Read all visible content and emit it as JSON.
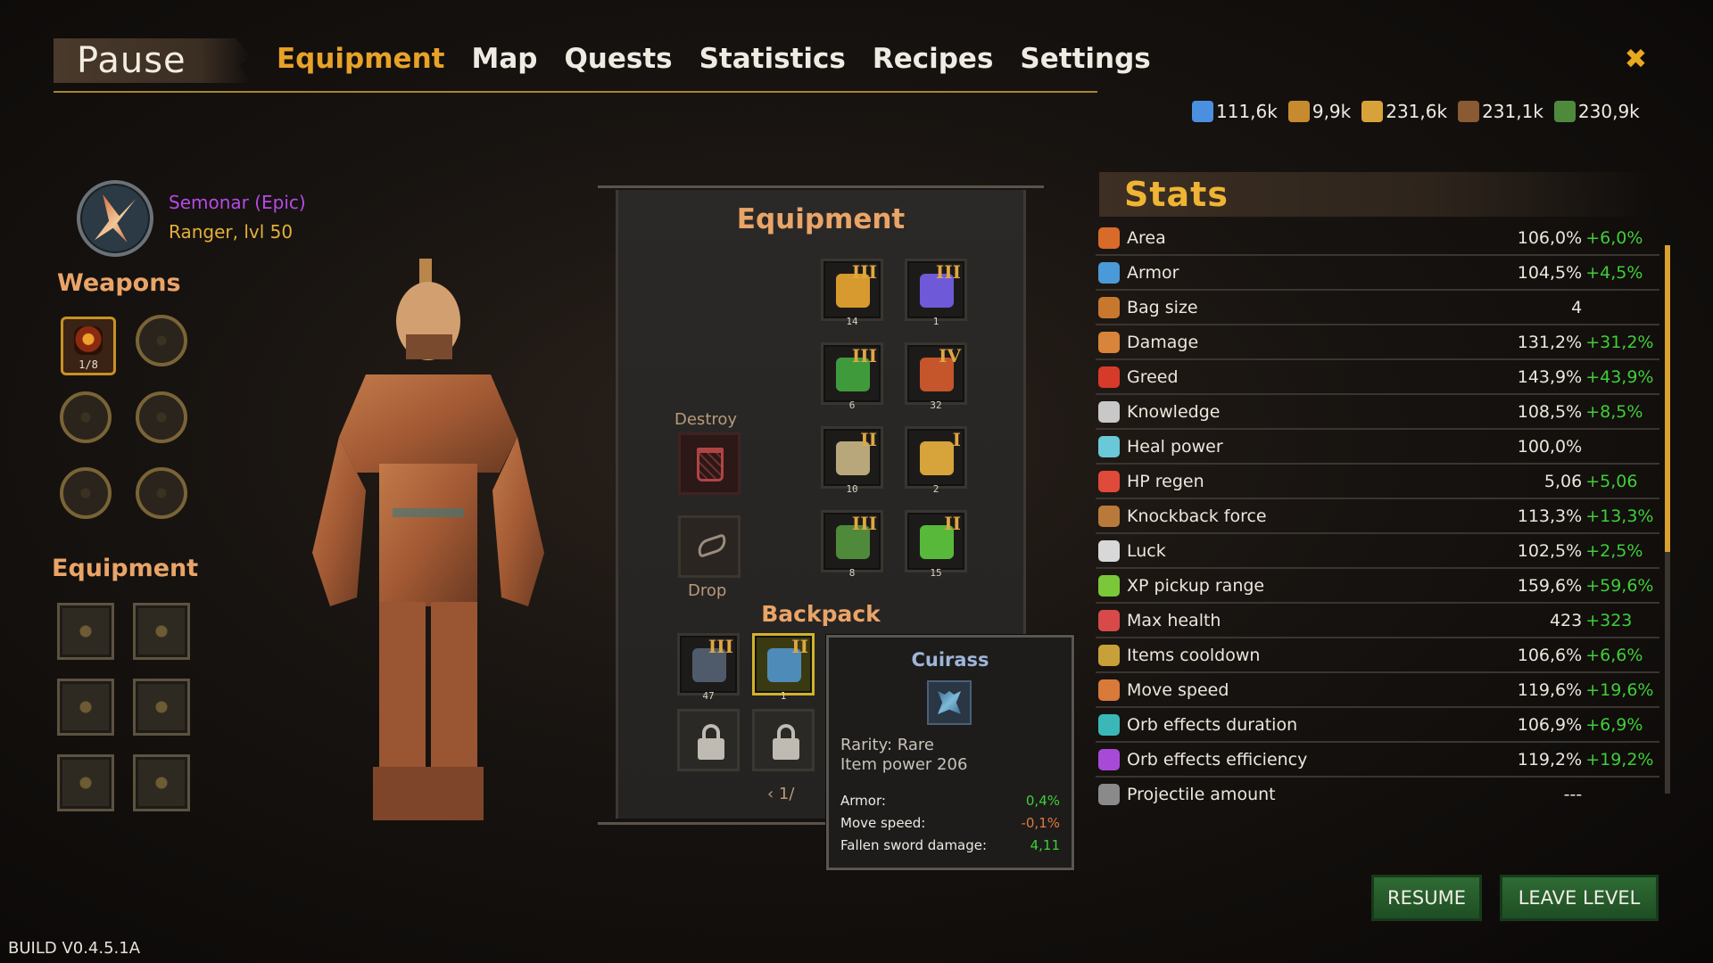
{
  "nav": {
    "pause": "Pause",
    "tabs": [
      "Equipment",
      "Map",
      "Quests",
      "Statistics",
      "Recipes",
      "Settings"
    ],
    "active": "Equipment",
    "close_icon": "close-x-icon"
  },
  "resources": [
    {
      "icon": "crystal-icon",
      "value": "111,6k",
      "color": "#4a8fe0"
    },
    {
      "icon": "bread-icon",
      "value": "9,9k",
      "color": "#c88a2e"
    },
    {
      "icon": "gold-pouch-icon",
      "value": "231,6k",
      "color": "#d8a23a"
    },
    {
      "icon": "wood-icon",
      "value": "231,1k",
      "color": "#8a5a32"
    },
    {
      "icon": "potion-icon",
      "value": "230,9k",
      "color": "#4f8a3c"
    }
  ],
  "hero": {
    "name": "Semonar (Epic)",
    "class": "Ranger, lvl 50"
  },
  "weapons": {
    "title": "Weapons",
    "active_count": "1/8"
  },
  "left_equipment": {
    "title": "Equipment"
  },
  "equipment_panel": {
    "title": "Equipment",
    "slots": [
      {
        "tier": "III",
        "level": "14",
        "name": "helmet-icon",
        "color": "#d79a2e"
      },
      {
        "tier": "III",
        "level": "1",
        "name": "gauntlet-icon",
        "color": "#6e5ad8"
      },
      {
        "tier": "III",
        "level": "6",
        "name": "amulet-icon",
        "color": "#3f9a3c"
      },
      {
        "tier": "IV",
        "level": "32",
        "name": "gloves-icon",
        "color": "#c5552b"
      },
      {
        "tier": "II",
        "level": "10",
        "name": "pants-icon",
        "color": "#b8a77a"
      },
      {
        "tier": "I",
        "level": "2",
        "name": "ring-icon",
        "color": "#d6a43a"
      },
      {
        "tier": "III",
        "level": "8",
        "name": "boots-icon",
        "color": "#4e8a3a"
      },
      {
        "tier": "II",
        "level": "15",
        "name": "bracelet-icon",
        "color": "#58b83a"
      }
    ],
    "destroy_label": "Destroy",
    "drop_label": "Drop"
  },
  "backpack": {
    "title": "Backpack",
    "items": [
      {
        "tier": "III",
        "level": "47",
        "name": "chest-armor-icon",
        "color": "#4f5b6a"
      },
      {
        "tier": "II",
        "level": "1",
        "name": "cuirass-icon",
        "color": "#4f8bb8"
      }
    ],
    "pager": "‹  1/"
  },
  "tooltip": {
    "title": "Cuirass",
    "rarity": "Rarity: Rare",
    "power": "Item power 206",
    "stats": [
      {
        "name": "Armor:",
        "value": "0,4%",
        "sign": "pos"
      },
      {
        "name": "Move speed:",
        "value": "-0,1%",
        "sign": "neg"
      },
      {
        "name": "Fallen sword damage:",
        "value": "4,11",
        "sign": "pos"
      }
    ]
  },
  "stats": {
    "title": "Stats",
    "rows": [
      {
        "icon": "area-icon",
        "color": "#d86a2a",
        "name": "Area",
        "value": "106,0%",
        "bonus": "+6,0%"
      },
      {
        "icon": "armor-icon",
        "color": "#4a9ad8",
        "name": "Armor",
        "value": "104,5%",
        "bonus": "+4,5%"
      },
      {
        "icon": "bag-icon",
        "color": "#c8782e",
        "name": "Bag size",
        "value": "4",
        "bonus": ""
      },
      {
        "icon": "damage-icon",
        "color": "#d8843a",
        "name": "Damage",
        "value": "131,2%",
        "bonus": "+31,2%"
      },
      {
        "icon": "greed-icon",
        "color": "#d83a2a",
        "name": "Greed",
        "value": "143,9%",
        "bonus": "+43,9%"
      },
      {
        "icon": "knowledge-icon",
        "color": "#c8c8c8",
        "name": "Knowledge",
        "value": "108,5%",
        "bonus": "+8,5%"
      },
      {
        "icon": "heal-power-icon",
        "color": "#6ac8d8",
        "name": "Heal power",
        "value": "100,0%",
        "bonus": ""
      },
      {
        "icon": "hp-regen-icon",
        "color": "#e04a3a",
        "name": "HP regen",
        "value": "5,06",
        "bonus": "+5,06"
      },
      {
        "icon": "knockback-icon",
        "color": "#b87a3a",
        "name": "Knockback force",
        "value": "113,3%",
        "bonus": "+13,3%"
      },
      {
        "icon": "luck-icon",
        "color": "#d8d8d8",
        "name": "Luck",
        "value": "102,5%",
        "bonus": "+2,5%"
      },
      {
        "icon": "xp-pickup-icon",
        "color": "#7ac83a",
        "name": "XP pickup range",
        "value": "159,6%",
        "bonus": "+59,6%"
      },
      {
        "icon": "max-health-icon",
        "color": "#d84a4a",
        "name": "Max health",
        "value": "423",
        "bonus": "+323"
      },
      {
        "icon": "cooldown-icon",
        "color": "#c8a03a",
        "name": "Items cooldown",
        "value": "106,6%",
        "bonus": "+6,6%"
      },
      {
        "icon": "move-speed-icon",
        "color": "#d87a3a",
        "name": "Move speed",
        "value": "119,6%",
        "bonus": "+19,6%"
      },
      {
        "icon": "orb-duration-icon",
        "color": "#3ab8b8",
        "name": "Orb effects duration",
        "value": "106,9%",
        "bonus": "+6,9%"
      },
      {
        "icon": "orb-efficiency-icon",
        "color": "#a84ad8",
        "name": "Orb effects efficiency",
        "value": "119,2%",
        "bonus": "+19,2%"
      },
      {
        "icon": "projectile-icon",
        "color": "#8a8a8a",
        "name": "Projectile amount",
        "value": "---",
        "bonus": ""
      }
    ]
  },
  "buttons": {
    "resume": "RESUME",
    "leave": "LEAVE LEVEL"
  },
  "build": "BUILD V0.4.5.1A"
}
